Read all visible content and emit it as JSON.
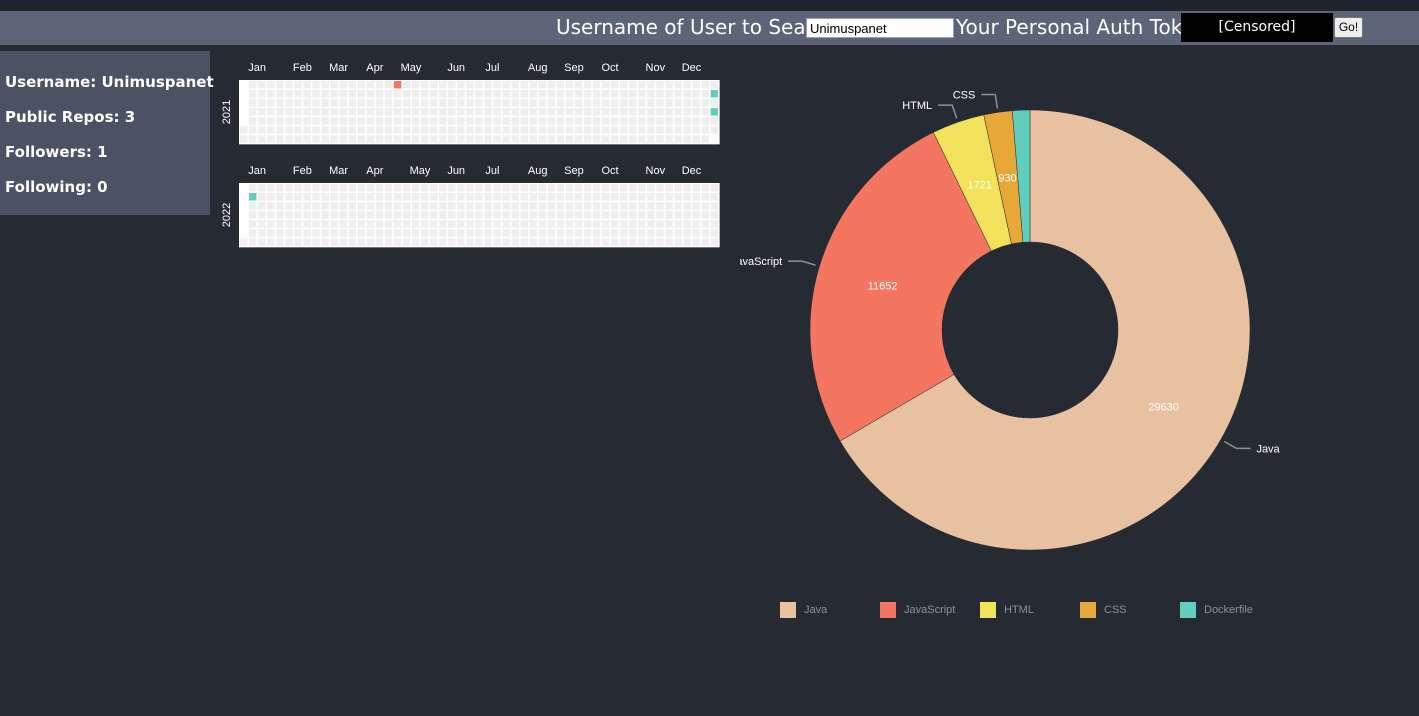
{
  "header": {
    "search_label": "Username of User to Search:",
    "search_value": "Unimuspanet",
    "token_label": "Your Personal Auth Token",
    "token_value": "[Censored]",
    "go_label": "Go!"
  },
  "profile": {
    "username": "Username: Unimuspanet",
    "public_repos": "Public Repos: 3",
    "followers": "Followers: 1",
    "following": "Following: 0"
  },
  "colors": {
    "background": "#262a33",
    "header": "#5b6577",
    "panel": "#4b5263",
    "heat_empty": "#eeeeee",
    "java": "#e8c1a0",
    "javascript": "#f47560",
    "html": "#f1e15b",
    "css": "#e8a838",
    "dockerfile": "#61cdbb"
  },
  "calendars": [
    {
      "year": "2021",
      "months": [
        "Jan",
        "Feb",
        "Mar",
        "Apr",
        "May",
        "Jun",
        "Jul",
        "Aug",
        "Sep",
        "Oct",
        "Nov",
        "Dec"
      ],
      "highlights": [
        {
          "date": "2021-04-25",
          "color": "#f47560"
        },
        {
          "date": "2021-12-27",
          "color": "#61cdbb"
        },
        {
          "date": "2021-12-29",
          "color": "#61cdbb"
        }
      ]
    },
    {
      "year": "2022",
      "months": [
        "Jan",
        "Feb",
        "Mar",
        "Apr",
        "May",
        "Jun",
        "Jul",
        "Aug",
        "Sep",
        "Oct",
        "Nov",
        "Dec"
      ],
      "highlights": [
        {
          "date": "2022-01-03",
          "color": "#61cdbb"
        }
      ]
    }
  ],
  "chart_data": {
    "type": "pie",
    "donut": true,
    "slices": [
      {
        "label": "Java",
        "value": 29630,
        "color": "#e8c1a0"
      },
      {
        "label": "JavaScript",
        "value": 11652,
        "color": "#f47560"
      },
      {
        "label": "HTML",
        "value": 1721,
        "color": "#f1e15b"
      },
      {
        "label": "CSS",
        "value": 930,
        "color": "#e8a838"
      },
      {
        "label": "Dockerfile",
        "value": 570,
        "color": "#61cdbb"
      }
    ],
    "legend_position": "bottom"
  }
}
